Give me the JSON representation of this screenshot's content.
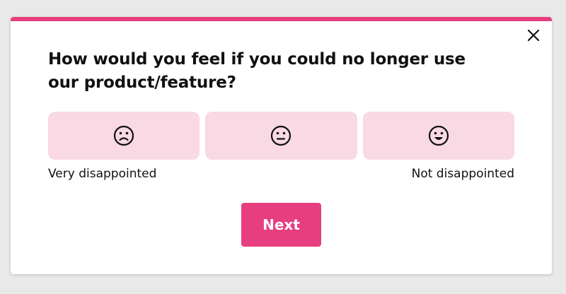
{
  "survey": {
    "question": "How would you feel if you could no longer use our product/feature?",
    "options": [
      {
        "icon": "sad-face-icon"
      },
      {
        "icon": "neutral-face-icon"
      },
      {
        "icon": "happy-face-icon"
      }
    ],
    "scale_label_low": "Very disappointed",
    "scale_label_high": "Not disappointed",
    "next_label": "Next"
  },
  "icons": {
    "close": "close-icon"
  },
  "colors": {
    "accent": "#e63e7e",
    "option_bg": "#f9d9e3",
    "text": "#111111",
    "background": "#e9e9e9"
  }
}
